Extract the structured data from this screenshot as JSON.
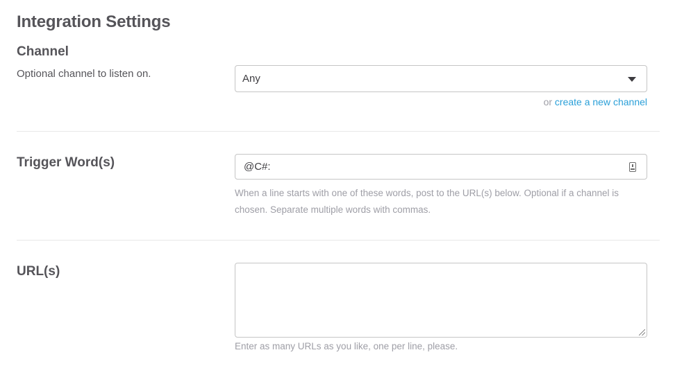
{
  "page": {
    "title": "Integration Settings"
  },
  "channel": {
    "label": "Channel",
    "description": "Optional channel to listen on.",
    "selected": "Any",
    "create_prefix": "or",
    "create_link": "create a new channel"
  },
  "trigger": {
    "label": "Trigger Word(s)",
    "value": "@C#:",
    "help": "When a line starts with one of these words, post to the URL(s) below. Optional if a channel is chosen. Separate multiple words with commas."
  },
  "urls": {
    "label": "URL(s)",
    "value": "",
    "help": "Enter as many URLs as you like, one per line, please."
  },
  "icons": {
    "select_caret": "caret-down-icon",
    "input_keyboard": "keyboard-icon",
    "textarea_resize": "resize-handle-icon"
  },
  "colors": {
    "text": "#555459",
    "muted": "#9e9ea6",
    "link": "#2a9fd8",
    "border": "#c5c5c5",
    "divider": "#e8e8e8"
  }
}
